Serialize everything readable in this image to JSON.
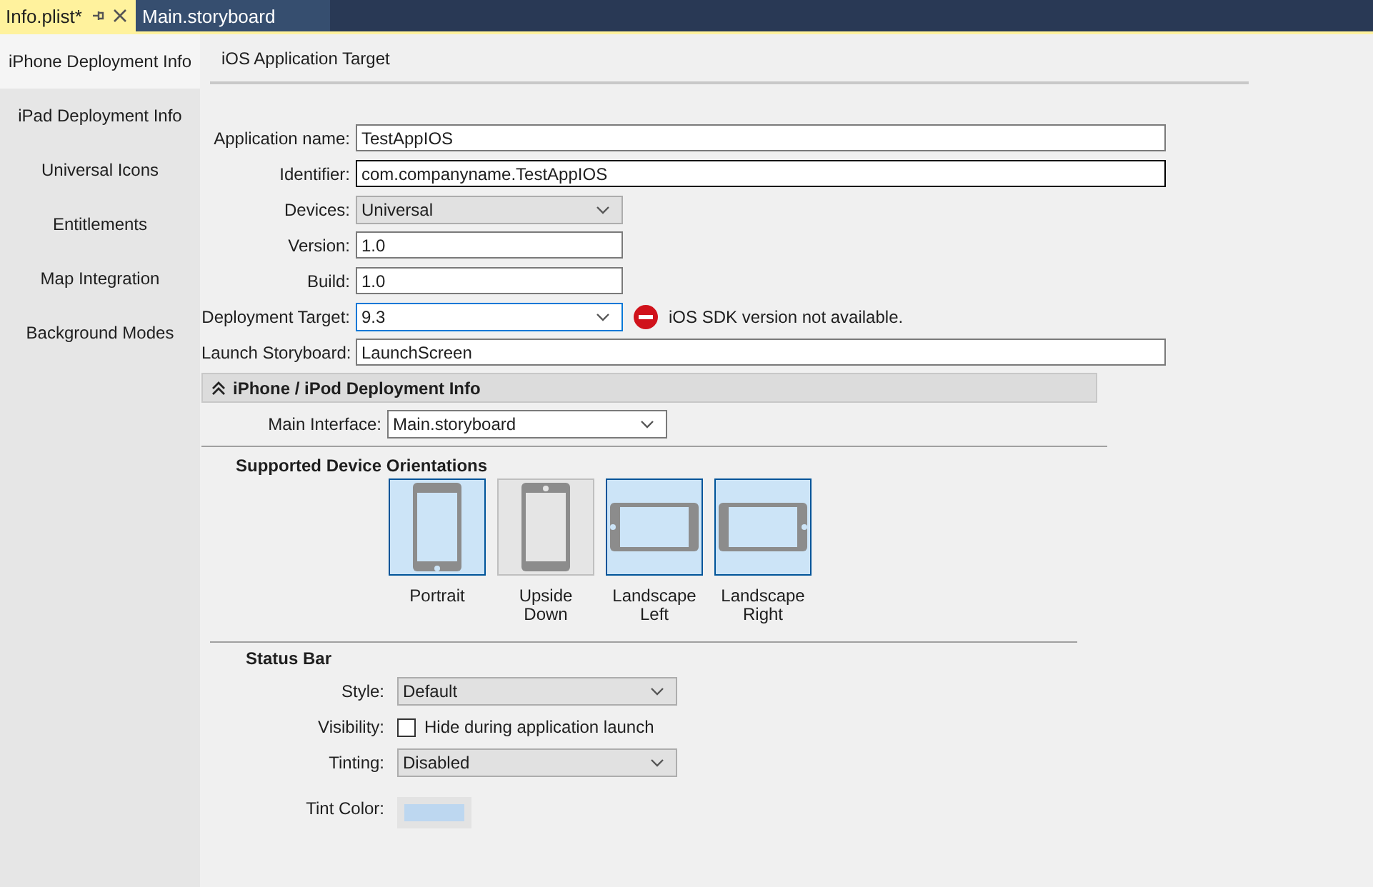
{
  "tabs": [
    {
      "label": "Info.plist*",
      "selected": true
    },
    {
      "label": "Main.storyboard",
      "selected": false
    }
  ],
  "sidebar": {
    "items": [
      {
        "label": "iPhone Deployment Info",
        "selected": true
      },
      {
        "label": "iPad Deployment Info",
        "selected": false
      },
      {
        "label": "Universal Icons",
        "selected": false
      },
      {
        "label": "Entitlements",
        "selected": false
      },
      {
        "label": "Map Integration",
        "selected": false
      },
      {
        "label": "Background Modes",
        "selected": false
      }
    ]
  },
  "section_title": "iOS Application Target",
  "fields": [
    {
      "kind": "text",
      "label": "Application name:",
      "value": "TestAppIOS",
      "focused": false
    },
    {
      "kind": "text",
      "label": "Identifier:",
      "value": "com.companyname.TestAppIOS",
      "focused": true
    },
    {
      "kind": "select",
      "label": "Devices:",
      "value": "Universal",
      "focused": false
    },
    {
      "kind": "short",
      "label": "Version:",
      "value": "1.0",
      "focused": false
    },
    {
      "kind": "short",
      "label": "Build:",
      "value": "1.0",
      "focused": false
    },
    {
      "kind": "combo",
      "label": "Deployment Target:",
      "value": "9.3",
      "focused": false,
      "hovered": true,
      "error": "iOS SDK version not available."
    },
    {
      "kind": "text",
      "label": "Launch Storyboard:",
      "value": "LaunchScreen",
      "focused": false
    }
  ],
  "deployment_section": {
    "title": "iPhone / iPod Deployment Info",
    "expanded": true,
    "main_interface": {
      "label": "Main Interface:",
      "value": "Main.storyboard"
    }
  },
  "orientations": {
    "title": "Supported Device Orientations",
    "items": [
      {
        "kind": "portrait",
        "label": "Portrait",
        "selected": true
      },
      {
        "kind": "upside-down",
        "label": "Upside Down",
        "selected": false
      },
      {
        "kind": "landscape-left",
        "label": "Landscape Left",
        "selected": true
      },
      {
        "kind": "landscape-right",
        "label": "Landscape Right",
        "selected": true
      }
    ]
  },
  "status_bar": {
    "title": "Status Bar",
    "style": {
      "label": "Style:",
      "value": "Default"
    },
    "visibility": {
      "label": "Visibility:",
      "option": "Hide during application launch",
      "checked": false
    },
    "tinting": {
      "label": "Tinting:",
      "value": "Disabled"
    },
    "tint_color": {
      "label": "Tint Color:",
      "color": "#bdd7f0"
    }
  }
}
